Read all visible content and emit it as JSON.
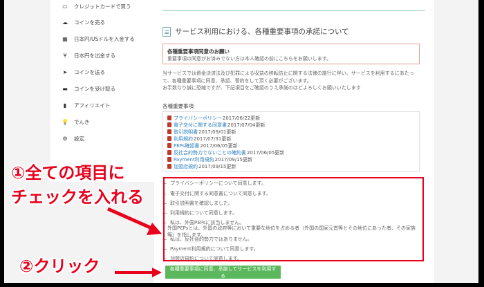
{
  "sidebar": {
    "items": [
      {
        "label": "クレジットカードで買う",
        "icon": "credit-card-icon"
      },
      {
        "label": "コインを売る",
        "icon": "cloud-upload-icon"
      },
      {
        "label": "日本円/USドルを入金する",
        "icon": "bank-icon"
      },
      {
        "label": "日本円を出金する",
        "icon": "yen-icon"
      },
      {
        "label": "コインを送る",
        "icon": "send-icon"
      },
      {
        "label": "コインを受け取る",
        "icon": "receive-icon"
      },
      {
        "label": "アフィリエイト",
        "icon": "chart-icon"
      },
      {
        "label": "でんき",
        "icon": "lightbulb-icon"
      },
      {
        "label": "設定",
        "icon": "gear-icon"
      }
    ]
  },
  "main": {
    "title": "サービス利用における、各種重要事項の承諾について",
    "alert": {
      "title": "各種重要事項同意のお願い",
      "body": "重要事項の同意がお済みでない方は本人確認の前にこちらをお願いします。"
    },
    "paragraph": [
      "当サービスでは資金決済法及び犯罪による収益の移転防止に関する法律の施行に伴い、サービスを利用するにあたっ",
      "て、各種重要事項に同意、承認、誓約をして頂く必要がございます。",
      "お手数なり誠に恐縮ですが、下記項目をご確認のうえ承諾のほどよろしくお願いいたします"
    ],
    "documents_heading": "各種重要事項",
    "documents": [
      {
        "name": "プライバシーポリシー",
        "date": "2017/06/22更新"
      },
      {
        "name": "電子交付に関する同意書",
        "date": "2017/07/04更新"
      },
      {
        "name": "取引説明書",
        "date": "2017/09/01更新"
      },
      {
        "name": "利用規約",
        "date": "2017/07/31更新"
      },
      {
        "name": "PEPs確認書",
        "date": "2017/06/05更新"
      },
      {
        "name": "反社会的勢力でないことの確約書",
        "date": "2017/06/05更新"
      },
      {
        "name": "Payment利用規約",
        "date": "2017/09/15更新"
      },
      {
        "name": "加盟店規約",
        "date": "2017/09/15更新"
      }
    ],
    "checkboxes": [
      "プライバシーポリシーについて同意します。",
      "電子交付に関する同意書について同意します。",
      "取引説明書を確認しました。",
      "利用規約について同意します。",
      "私は、外国PEPsに該当しません。",
      "外国PEPsとは、外国の政府等において重要な地位を占める者（外国の国家元首等とその地位にあった者、その家族等）を指します。",
      "私は、反社会的勢力ではありません。",
      "Payment利用規約について同意します。",
      "加盟店規約について同意します。"
    ],
    "submit_label": "各種重要事項に同意、承諾してサービスを利用する"
  },
  "annotations": {
    "step1_line1": "①全ての項目に",
    "step1_line2": "チェックを入れる",
    "step2": "②クリック",
    "color": "#e8001c"
  }
}
